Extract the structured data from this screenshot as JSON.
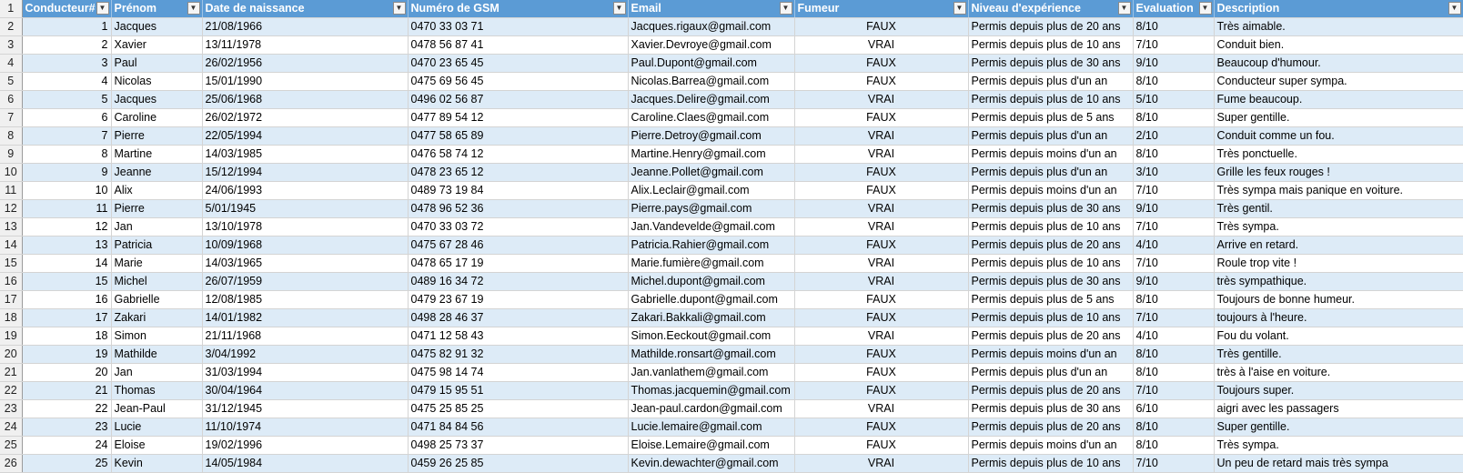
{
  "headers": [
    "Conducteur#",
    "Prénom",
    "Date de naissance",
    "Numéro de GSM",
    "Email",
    "Fumeur",
    "Niveau d'expérience",
    "Evaluation",
    "Description"
  ],
  "header_row_number": "1",
  "icons": {
    "filter": "filter-dropdown-icon"
  },
  "colors": {
    "header_bg": "#5b9bd5",
    "band_bg": "#ddebf7"
  },
  "rows": [
    {
      "rn": "2",
      "id": "1",
      "prenom": "Jacques",
      "dob": "21/08/1966",
      "gsm": "0470 33 03 71",
      "email": "Jacques.rigaux@gmail.com",
      "fumeur": "FAUX",
      "niveau": "Permis depuis plus de 20 ans",
      "eval": "8/10",
      "desc": "Très aimable."
    },
    {
      "rn": "3",
      "id": "2",
      "prenom": "Xavier",
      "dob": "13/11/1978",
      "gsm": "0478 56 87 41",
      "email": "Xavier.Devroye@gmail.com",
      "fumeur": "VRAI",
      "niveau": "Permis depuis plus de 10 ans",
      "eval": "7/10",
      "desc": "Conduit bien."
    },
    {
      "rn": "4",
      "id": "3",
      "prenom": "Paul",
      "dob": "26/02/1956",
      "gsm": "0470 23 65 45",
      "email": "Paul.Dupont@gmail.com",
      "fumeur": "FAUX",
      "niveau": "Permis depuis plus de 30 ans",
      "eval": "9/10",
      "desc": "Beaucoup d'humour."
    },
    {
      "rn": "5",
      "id": "4",
      "prenom": "Nicolas",
      "dob": "15/01/1990",
      "gsm": "0475 69 56 45",
      "email": "Nicolas.Barrea@gmail.com",
      "fumeur": "FAUX",
      "niveau": "Permis depuis plus d'un an",
      "eval": "8/10",
      "desc": "Conducteur super sympa."
    },
    {
      "rn": "6",
      "id": "5",
      "prenom": "Jacques",
      "dob": "25/06/1968",
      "gsm": "0496 02 56 87",
      "email": "Jacques.Delire@gmail.com",
      "fumeur": "VRAI",
      "niveau": "Permis depuis plus de 10 ans",
      "eval": "5/10",
      "desc": "Fume beaucoup."
    },
    {
      "rn": "7",
      "id": "6",
      "prenom": "Caroline",
      "dob": "26/02/1972",
      "gsm": "0477 89 54 12",
      "email": "Caroline.Claes@gmail.com",
      "fumeur": "FAUX",
      "niveau": "Permis depuis plus de 5 ans",
      "eval": "8/10",
      "desc": "Super gentille."
    },
    {
      "rn": "8",
      "id": "7",
      "prenom": "Pierre",
      "dob": "22/05/1994",
      "gsm": "0477 58 65 89",
      "email": "Pierre.Detroy@gmail.com",
      "fumeur": "VRAI",
      "niveau": "Permis depuis plus d'un an",
      "eval": "2/10",
      "desc": "Conduit comme un fou."
    },
    {
      "rn": "9",
      "id": "8",
      "prenom": "Martine",
      "dob": "14/03/1985",
      "gsm": "0476 58 74 12",
      "email": "Martine.Henry@gmail.com",
      "fumeur": "VRAI",
      "niveau": "Permis depuis moins d'un an",
      "eval": "8/10",
      "desc": "Très ponctuelle."
    },
    {
      "rn": "10",
      "id": "9",
      "prenom": "Jeanne",
      "dob": "15/12/1994",
      "gsm": "0478 23 65 12",
      "email": "Jeanne.Pollet@gmail.com",
      "fumeur": "FAUX",
      "niveau": "Permis depuis plus d'un an",
      "eval": "3/10",
      "desc": "Grille les feux rouges !"
    },
    {
      "rn": "11",
      "id": "10",
      "prenom": "Alix",
      "dob": "24/06/1993",
      "gsm": "0489 73 19 84",
      "email": "Alix.Leclair@gmail.com",
      "fumeur": "FAUX",
      "niveau": "Permis depuis moins d'un an",
      "eval": "7/10",
      "desc": "Très sympa mais panique en voiture."
    },
    {
      "rn": "12",
      "id": "11",
      "prenom": "Pierre",
      "dob": "5/01/1945",
      "gsm": "0478 96 52 36",
      "email": "Pierre.pays@gmail.com",
      "fumeur": "VRAI",
      "niveau": "Permis depuis plus de 30 ans",
      "eval": "9/10",
      "desc": "Très gentil."
    },
    {
      "rn": "13",
      "id": "12",
      "prenom": "Jan",
      "dob": "13/10/1978",
      "gsm": "0470 33 03 72",
      "email": "Jan.Vandevelde@gmail.com",
      "fumeur": "VRAI",
      "niveau": "Permis depuis plus de 10 ans",
      "eval": "7/10",
      "desc": "Très sympa."
    },
    {
      "rn": "14",
      "id": "13",
      "prenom": "Patricia",
      "dob": "10/09/1968",
      "gsm": "0475 67 28 46",
      "email": "Patricia.Rahier@gmail.com",
      "fumeur": "FAUX",
      "niveau": "Permis depuis plus de 20 ans",
      "eval": "4/10",
      "desc": "Arrive en retard."
    },
    {
      "rn": "15",
      "id": "14",
      "prenom": "Marie",
      "dob": "14/03/1965",
      "gsm": "0478 65 17 19",
      "email": "Marie.fumière@gmail.com",
      "fumeur": "VRAI",
      "niveau": "Permis depuis plus de 10 ans",
      "eval": "7/10",
      "desc": "Roule trop vite !"
    },
    {
      "rn": "16",
      "id": "15",
      "prenom": "Michel",
      "dob": "26/07/1959",
      "gsm": "0489 16 34 72",
      "email": "Michel.dupont@gmail.com",
      "fumeur": "VRAI",
      "niveau": "Permis depuis plus de 30 ans",
      "eval": "9/10",
      "desc": "très sympathique."
    },
    {
      "rn": "17",
      "id": "16",
      "prenom": "Gabrielle",
      "dob": "12/08/1985",
      "gsm": "0479 23 67 19",
      "email": "Gabrielle.dupont@gmail.com",
      "fumeur": "FAUX",
      "niveau": "Permis depuis plus de 5 ans",
      "eval": "8/10",
      "desc": "Toujours de bonne humeur."
    },
    {
      "rn": "18",
      "id": "17",
      "prenom": "Zakari",
      "dob": "14/01/1982",
      "gsm": "0498 28 46 37",
      "email": "Zakari.Bakkali@gmail.com",
      "fumeur": "FAUX",
      "niveau": "Permis depuis plus de 10 ans",
      "eval": "7/10",
      "desc": "toujours à l'heure."
    },
    {
      "rn": "19",
      "id": "18",
      "prenom": "Simon",
      "dob": "21/11/1968",
      "gsm": "0471 12 58 43",
      "email": "Simon.Eeckout@gmail.com",
      "fumeur": "VRAI",
      "niveau": "Permis depuis plus de 20 ans",
      "eval": "4/10",
      "desc": "Fou du volant."
    },
    {
      "rn": "20",
      "id": "19",
      "prenom": "Mathilde",
      "dob": "3/04/1992",
      "gsm": "0475 82 91 32",
      "email": "Mathilde.ronsart@gmail.com",
      "fumeur": "FAUX",
      "niveau": "Permis depuis moins d'un an",
      "eval": "8/10",
      "desc": "Très gentille."
    },
    {
      "rn": "21",
      "id": "20",
      "prenom": "Jan",
      "dob": "31/03/1994",
      "gsm": "0475 98 14 74",
      "email": "Jan.vanlathem@gmail.com",
      "fumeur": "FAUX",
      "niveau": "Permis depuis plus d'un an",
      "eval": "8/10",
      "desc": "très à l'aise en voiture."
    },
    {
      "rn": "22",
      "id": "21",
      "prenom": "Thomas",
      "dob": "30/04/1964",
      "gsm": "0479 15 95 51",
      "email": "Thomas.jacquemin@gmail.com",
      "fumeur": "FAUX",
      "niveau": "Permis depuis plus de 20 ans",
      "eval": "7/10",
      "desc": "Toujours super."
    },
    {
      "rn": "23",
      "id": "22",
      "prenom": "Jean-Paul",
      "dob": "31/12/1945",
      "gsm": "0475 25 85 25",
      "email": "Jean-paul.cardon@gmail.com",
      "fumeur": "VRAI",
      "niveau": "Permis depuis plus de 30 ans",
      "eval": "6/10",
      "desc": "aigri avec les passagers"
    },
    {
      "rn": "24",
      "id": "23",
      "prenom": "Lucie",
      "dob": "11/10/1974",
      "gsm": "0471 84 84 56",
      "email": "Lucie.lemaire@gmail.com",
      "fumeur": "FAUX",
      "niveau": "Permis depuis plus de 20 ans",
      "eval": "8/10",
      "desc": "Super gentille."
    },
    {
      "rn": "25",
      "id": "24",
      "prenom": "Eloise",
      "dob": "19/02/1996",
      "gsm": "0498 25 73 37",
      "email": "Eloise.Lemaire@gmail.com",
      "fumeur": "FAUX",
      "niveau": "Permis depuis moins d'un an",
      "eval": "8/10",
      "desc": "Très sympa."
    },
    {
      "rn": "26",
      "id": "25",
      "prenom": "Kevin",
      "dob": "14/05/1984",
      "gsm": "0459 26 25 85",
      "email": "Kevin.dewachter@gmail.com",
      "fumeur": "VRAI",
      "niveau": "Permis depuis plus de 10 ans",
      "eval": "7/10",
      "desc": "Un peu de retard mais très sympa"
    }
  ]
}
